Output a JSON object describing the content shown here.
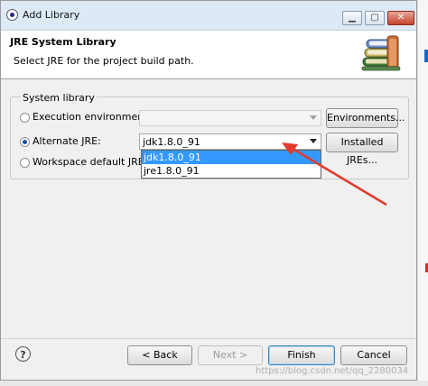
{
  "window": {
    "title": "Add Library"
  },
  "header": {
    "title": "JRE System Library",
    "description": "Select JRE for the project build path."
  },
  "group": {
    "legend": "System library"
  },
  "options": {
    "execution_env": {
      "label": "Execution environment:",
      "selected": false,
      "combo_value": "",
      "button": "Environments..."
    },
    "alternate_jre": {
      "label": "Alternate JRE:",
      "selected": true,
      "combo_value": "jdk1.8.0_91",
      "button": "Installed JREs..."
    },
    "workspace_default": {
      "label": "Workspace default JRE (jd",
      "selected": false
    }
  },
  "dropdown": {
    "items": [
      "jdk1.8.0_91",
      "jre1.8.0_91"
    ],
    "selected_index": 0
  },
  "footer": {
    "help_label": "?",
    "back": "< Back",
    "next": "Next >",
    "finish": "Finish",
    "cancel": "Cancel"
  },
  "watermark": "https://blog.csdn.net/qq_2280034",
  "colors": {
    "annotation_arrow": "#e23b2e",
    "selection": "#3399ff"
  }
}
